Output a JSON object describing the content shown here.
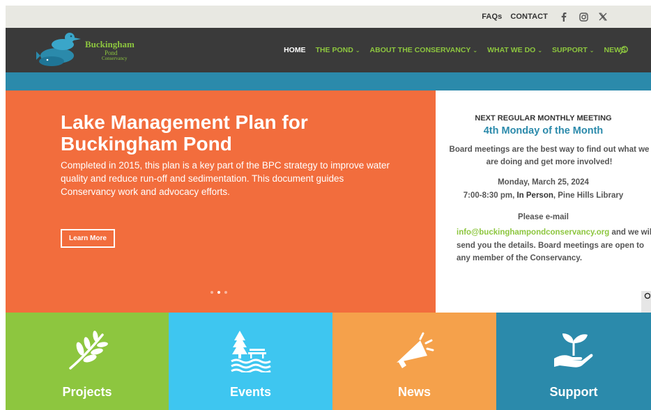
{
  "topbar": {
    "links": [
      "FAQs",
      "CONTACT"
    ],
    "social": [
      "facebook-icon",
      "instagram-icon",
      "x-icon"
    ]
  },
  "header": {
    "logo": {
      "line1": "Buckingham",
      "line2": "Pond",
      "line3": "Conservancy"
    },
    "nav": [
      {
        "label": "HOME",
        "active": true,
        "dropdown": false
      },
      {
        "label": "THE POND",
        "active": false,
        "dropdown": true
      },
      {
        "label": "ABOUT THE CONSERVANCY",
        "active": false,
        "dropdown": true
      },
      {
        "label": "WHAT WE DO",
        "active": false,
        "dropdown": true
      },
      {
        "label": "SUPPORT",
        "active": false,
        "dropdown": true
      },
      {
        "label": "NEWS",
        "active": false,
        "dropdown": false
      }
    ],
    "chevron": "⌄"
  },
  "hero": {
    "title": "Lake Management Plan for Buckingham Pond",
    "body": "Completed in 2015, this plan is a key part of the BPC strategy to improve water quality and reduce run-off and sedimentation. This document guides Conservancy work and advocacy efforts.",
    "button": "Learn More",
    "slide_count": 3,
    "active_slide": 2
  },
  "meeting": {
    "heading": "NEXT REGULAR MONTHLY MEETING",
    "schedule": "4th Monday of the Month",
    "intro": "Board meetings are the best way to find out what we are doing and get more involved!",
    "date": "Monday, March 25, 2024",
    "time_prefix": "7:00-8:30 pm, ",
    "in_person": "In Person",
    "location": ", Pine Hills Library",
    "contact_lead": "Please e-mail",
    "email": "info@buckinghampondconservancy.org",
    "contact_tail": " and we will send you the details.  Board meetings are open to any member of the Conservancy."
  },
  "tiles": [
    {
      "label": "Projects",
      "icon": "branch-leaves-icon",
      "color": "#8dc63f"
    },
    {
      "label": "Events",
      "icon": "tree-bench-water-icon",
      "color": "#3ec6f0"
    },
    {
      "label": "News",
      "icon": "megaphone-icon",
      "color": "#f5a14b"
    },
    {
      "label": "Support",
      "icon": "hand-plant-icon",
      "color": "#2b8aab"
    }
  ],
  "colors": {
    "hero": "#f26d3d",
    "header": "#3a3a3a",
    "accent_green": "#8dc63f",
    "accent_blue": "#2b8aab"
  }
}
